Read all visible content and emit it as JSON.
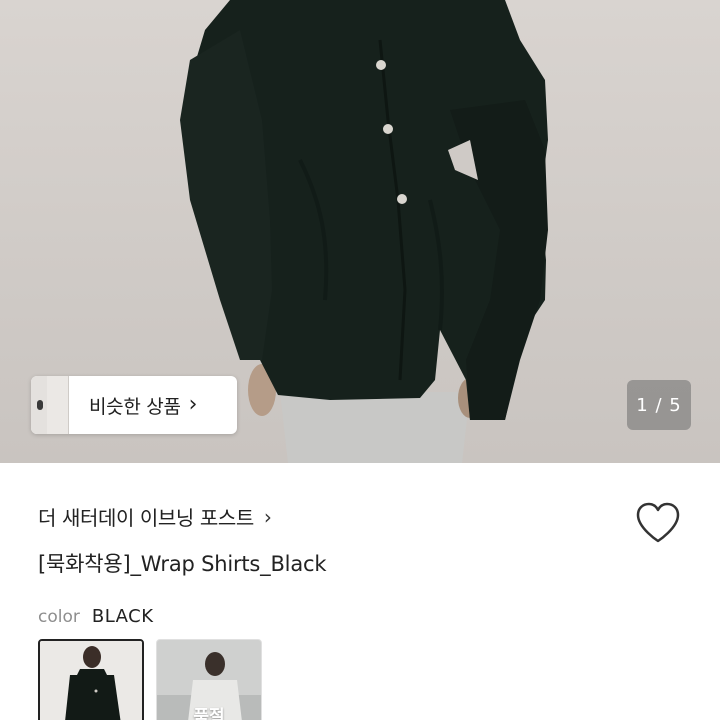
{
  "similar": {
    "label": "비슷한 상품",
    "chevron": "chevron-right-icon"
  },
  "gallery": {
    "counter": "1 / 5"
  },
  "shop": {
    "name": "더 새터데이 이브닝 포스트",
    "chevron": "chevron-right-icon"
  },
  "product": {
    "title": "[묵화착용]_Wrap Shirts_Black",
    "wishlist_icon": "heart-outline-icon"
  },
  "option": {
    "key": "color",
    "value": "BLACK",
    "swatches": [
      {
        "selected": true,
        "badge": ""
      },
      {
        "selected": false,
        "badge": "품절"
      }
    ]
  },
  "colors": {
    "shirt": "#16211c",
    "background": "#d5d0cc",
    "pants": "#c8c8c6",
    "accent": "#222222"
  }
}
